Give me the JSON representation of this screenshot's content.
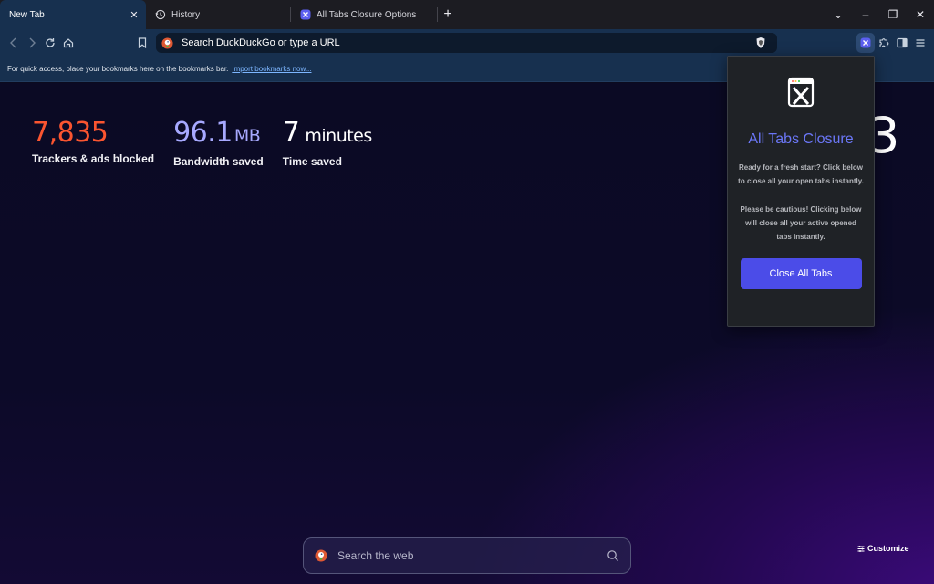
{
  "tabs": [
    {
      "label": "New Tab",
      "active": true
    },
    {
      "label": "History",
      "active": false
    },
    {
      "label": "All Tabs Closure Options",
      "active": false
    }
  ],
  "window_controls": {
    "tab_search": "⌄",
    "minimize": "–",
    "restore": "❐",
    "close": "✕"
  },
  "new_tab_symbol": "+",
  "tab_close_symbol": "✕",
  "omnibox": {
    "placeholder": "Search DuckDuckGo or type a URL"
  },
  "bookmarks_bar": {
    "message": "For quick access, place your bookmarks here on the bookmarks bar.",
    "link": "Import bookmarks now..."
  },
  "stats": [
    {
      "value": "7,835",
      "unit": "",
      "label": "Trackers & ads blocked"
    },
    {
      "value": "96.1",
      "unit": "MB",
      "label": "Bandwidth saved"
    },
    {
      "value": "7",
      "unit": "minutes",
      "label": "Time saved"
    }
  ],
  "clock_peek": "3",
  "search": {
    "placeholder": "Search the web"
  },
  "customize": {
    "label": "Customize"
  },
  "popup": {
    "title": "All Tabs Closure",
    "description": "Ready for a fresh start? Click below to close all your open tabs instantly.",
    "warning": "Please be cautious! Clicking below will close all your active opened tabs instantly.",
    "button": "Close All Tabs"
  },
  "colors": {
    "trackers": "#fb5530",
    "bandwidth": "#a7a9ff",
    "popup_title": "#6b77f7",
    "popup_button": "#4b4ce8",
    "toolbar": "#17304f"
  },
  "icons": [
    "history-icon",
    "extension-x-icon",
    "back-icon",
    "forward-icon",
    "reload-icon",
    "home-icon",
    "bookmark-icon",
    "duckduckgo-icon",
    "brave-shield-icon",
    "puzzle-icon",
    "sidebar-icon",
    "menu-icon",
    "search-icon",
    "customize-icon"
  ]
}
